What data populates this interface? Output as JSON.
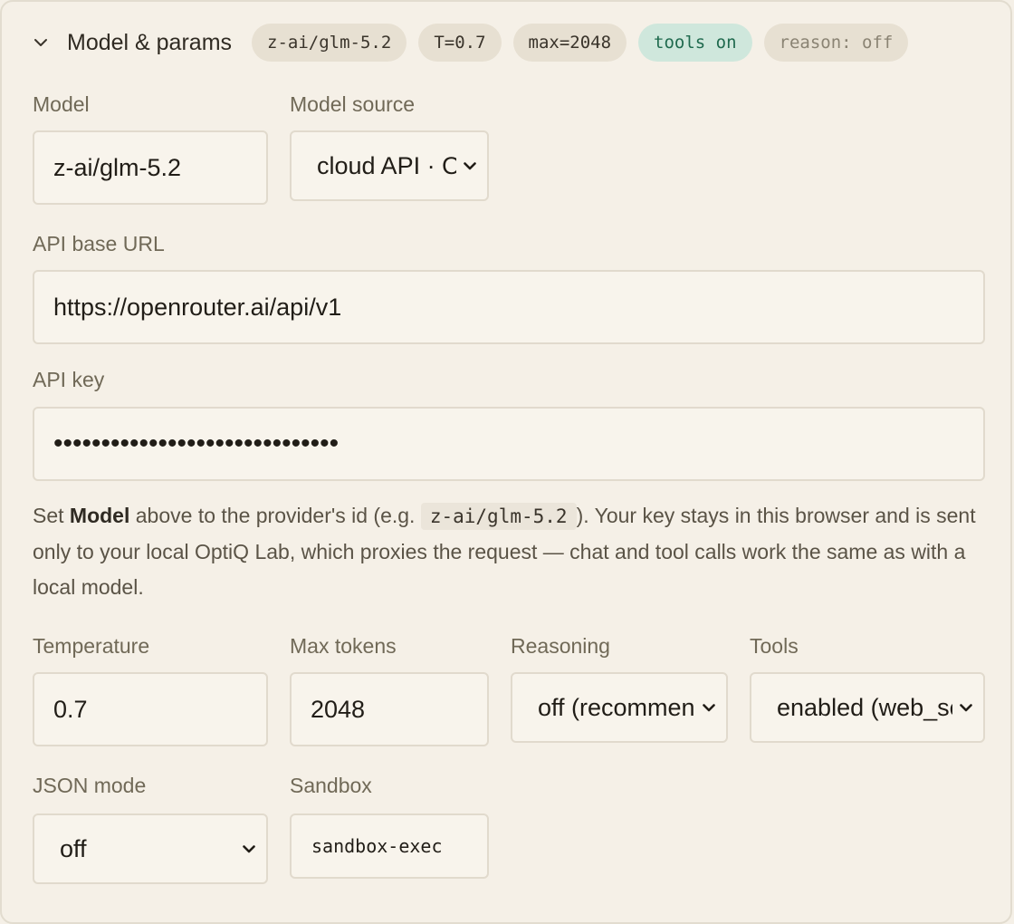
{
  "header": {
    "title": "Model & params",
    "badges": {
      "model": "z-ai/glm-5.2",
      "temperature": "T=0.7",
      "max": "max=2048",
      "tools": "tools on",
      "reason": "reason: off"
    }
  },
  "model": {
    "label": "Model",
    "value": "z-ai/glm-5.2"
  },
  "model_source": {
    "label": "Model source",
    "value": "cloud API · Op"
  },
  "api_base": {
    "label": "API base URL",
    "value": "https://openrouter.ai/api/v1"
  },
  "api_key": {
    "label": "API key",
    "value": "••••••••••••••••••••••••••••••"
  },
  "help": {
    "part1": "Set ",
    "bold": "Model",
    "part2": " above to the provider's id (e.g. ",
    "code": "z-ai/glm-5.2",
    "part3": "). Your key stays in this browser and is sent only to your local OptiQ Lab, which proxies the request — chat and tool calls work the same as with a local model."
  },
  "temperature": {
    "label": "Temperature",
    "value": "0.7"
  },
  "max_tokens": {
    "label": "Max tokens",
    "value": "2048"
  },
  "reasoning": {
    "label": "Reasoning",
    "value": "off (recommen"
  },
  "tools": {
    "label": "Tools",
    "value": "enabled (web_se"
  },
  "json_mode": {
    "label": "JSON mode",
    "value": "off"
  },
  "sandbox": {
    "label": "Sandbox",
    "value": "sandbox-exec"
  },
  "colors": {
    "background": "#f5f0e7",
    "pill": "#e7e0d2",
    "pill_green": "#cfe7dc",
    "pill_green_text": "#1f6a4e"
  }
}
